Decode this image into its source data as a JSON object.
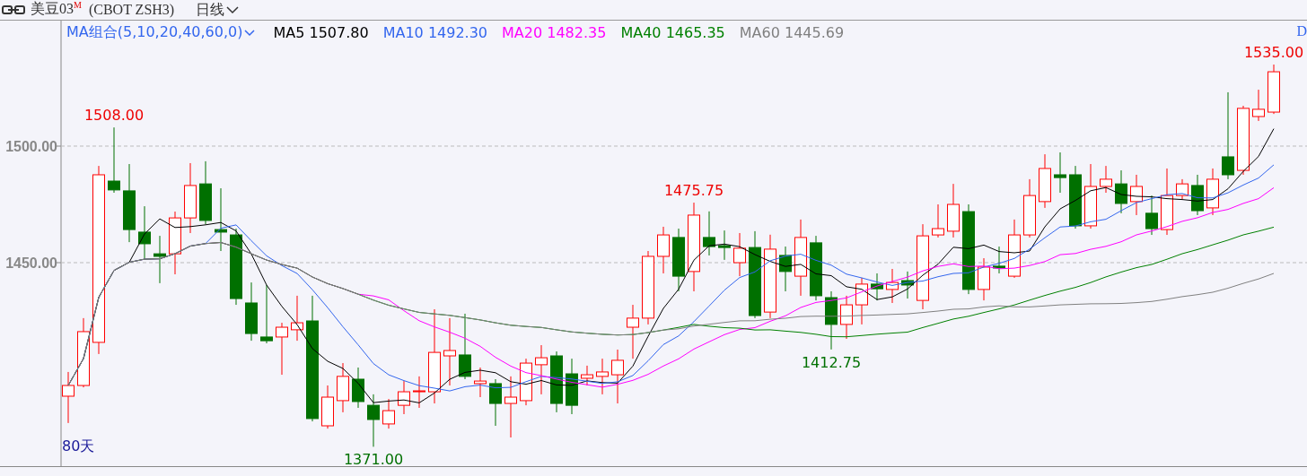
{
  "header": {
    "symbol": "美豆03$^{M}$",
    "code": "(CBOT ZSH3)",
    "period": "日线"
  },
  "legend": {
    "group": "MA组合(5,10,20,40,60,0)",
    "items": [
      {
        "label": "MA5",
        "value": "1507.80",
        "color": "#000000"
      },
      {
        "label": "MA10",
        "value": "1492.30",
        "color": "#3366ee"
      },
      {
        "label": "MA20",
        "value": "1482.35",
        "color": "#ff00ff"
      },
      {
        "label": "MA40",
        "value": "1465.35",
        "color": "#008000"
      },
      {
        "label": "MA60",
        "value": "1445.69",
        "color": "#808080"
      }
    ],
    "corner": "D"
  },
  "price_axis": [
    "1500.00",
    "1450.00"
  ],
  "price_labels": [
    {
      "text": "1508.00",
      "kind": "high"
    },
    {
      "text": "1475.75",
      "kind": "high"
    },
    {
      "text": "1535.00",
      "kind": "high"
    },
    {
      "text": "1371.00",
      "kind": "low"
    },
    {
      "text": "1412.75",
      "kind": "low"
    }
  ],
  "range_label": "80天"
}
